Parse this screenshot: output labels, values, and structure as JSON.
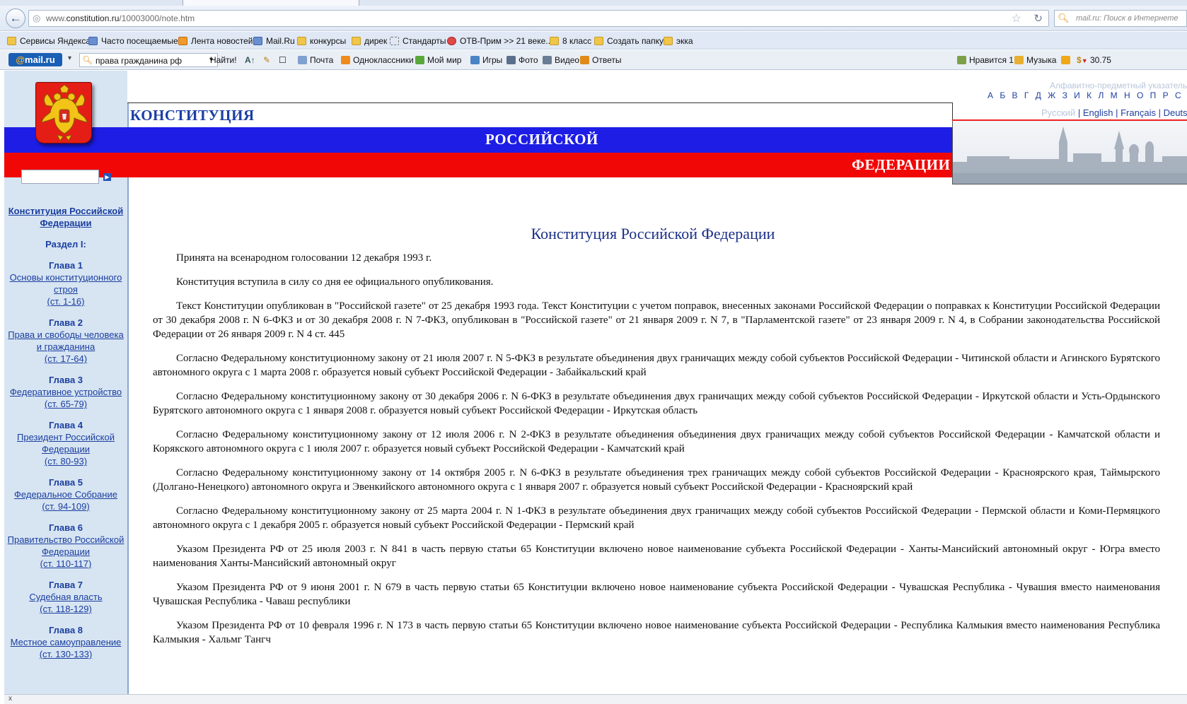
{
  "browser": {
    "url_prefix": "www.",
    "url_domain": "constitution.ru",
    "url_path": "/10003000/note.htm",
    "search_placeholder": "mail.ru: Поиск в Интернете"
  },
  "bookmarks": [
    "Сервисы Яндекса",
    "Часто посещаемые",
    "Лента новостей",
    "Mail.Ru",
    "конкурсы",
    "дирек",
    "Стандарты",
    "ОТВ-Прим >> 21 веке...",
    "8 класс",
    "Создать папку",
    "экка"
  ],
  "mailbar": {
    "logo_at": "@",
    "logo_text": "mail.ru",
    "search_value": "права гражданина рф",
    "find_label": "Найти!",
    "links": [
      "Почта",
      "Одноклассники",
      "Мой мир",
      "Игры",
      "Фото",
      "Видео",
      "Ответы"
    ],
    "likes_label": "Нравится 1",
    "music_label": "Музыка",
    "rate_label": "30.75"
  },
  "site": {
    "header_word1": "КОНСТИТУЦИЯ",
    "header_word2": "РОССИЙСКОЙ",
    "header_word3": "ФЕДЕРАЦИИ",
    "alpha_index_title": "Алфавитно-предметный указатель",
    "alpha_letters": "А Б В Г Д Ж З И К Л М Н О П Р С Т У Ф Ц Ч Я",
    "lang_current": "Русский",
    "lang_en": "English",
    "lang_fr": "Français",
    "lang_de": "Deutsch",
    "lang_sep": " | "
  },
  "toc": {
    "title": "Конституция Российской Федерации",
    "section": "Раздел I:",
    "chapters": [
      {
        "head": "Глава 1",
        "title": "Основы конституционного строя",
        "range": "(ст. 1-16)"
      },
      {
        "head": "Глава 2",
        "title": "Права и свободы человека и гражданина",
        "range": "(ст. 17-64)"
      },
      {
        "head": "Глава 3",
        "title": "Федеративное устройство",
        "range": "(ст. 65-79)"
      },
      {
        "head": "Глава 4",
        "title": "Президент Российской Федерации",
        "range": "(ст. 80-93)"
      },
      {
        "head": "Глава 5",
        "title": "Федеральное Собрание",
        "range": "(ст. 94-109)"
      },
      {
        "head": "Глава 6",
        "title": "Правительство Российской Федерации",
        "range": "(ст. 110-117)"
      },
      {
        "head": "Глава 7",
        "title": "Судебная власть",
        "range": "(ст. 118-129)"
      },
      {
        "head": "Глава 8",
        "title": "Местное самоуправление",
        "range": "(ст. 130-133)"
      }
    ]
  },
  "document": {
    "title": "Конституция Российской Федерации",
    "paragraphs": [
      "Принята на всенародном голосовании 12 декабря 1993 г.",
      "Конституция вступила в силу со дня ее официального опубликования.",
      "Текст Конституции опубликован в \"Российской газете\" от 25 декабря 1993 года. Текст Конституции с учетом поправок, внесенных законами Российской Федерации о поправках к Конституции Российской Федерации от 30 декабря 2008 г. N 6-ФКЗ и от 30 декабря 2008 г. N 7-ФКЗ, опубликован в \"Российской газете\" от 21 января 2009 г. N 7, в \"Парламентской газете\" от 23 января 2009 г. N 4, в Собрании законодательства Российской Федерации от 26 января 2009 г. N 4 ст. 445",
      "Согласно Федеральному конституционному закону от 21 июля 2007 г. N 5-ФКЗ в результате объединения двух граничащих между собой субъектов Российской Федерации - Читинской области и Агинского Бурятского автономного округа с 1 марта 2008 г. образуется новый субъект Российской Федерации - Забайкальский край",
      "Согласно Федеральному конституционному закону от 30 декабря 2006 г. N 6-ФКЗ в результате объединения двух граничащих между собой субъектов Российской Федерации - Иркутской области и Усть-Ордынского Бурятского автономного округа с 1 января 2008 г. образуется новый субъект Российской Федерации - Иркутская область",
      "Согласно Федеральному конституционному закону от 12 июля 2006 г. N 2-ФКЗ в результате объединения объединения двух граничащих между собой субъектов Российской Федерации - Камчатской области и Корякского автономного округа с 1 июля 2007 г. образуется новый субъект Российской Федерации - Камчатский край",
      "Согласно Федеральному конституционному закону от 14 октября 2005 г. N 6-ФКЗ в результате объединения трех граничащих между собой субъектов Российской Федерации - Красноярского края, Таймырского (Долгано-Ненецкого) автономного округа и Эвенкийского автономного округа с 1 января 2007 г. образуется новый субъект Российской Федерации - Красноярский край",
      "Согласно Федеральному конституционному закону от 25 марта 2004 г. N 1-ФКЗ в результате объединения двух граничащих между собой субъектов Российской Федерации - Пермской области и Коми-Пермяцкого автономного округа с 1 декабря 2005 г. образуется новый субъект Российской Федерации - Пермский край",
      "Указом Президента РФ от 25 июля 2003 г. N 841 в часть первую статьи 65 Конституции включено новое наименование субъекта Российской Федерации - Ханты-Мансийский автономный округ - Югра вместо наименования Ханты-Мансийский автономный округ",
      "Указом Президента РФ от 9 июня 2001 г. N 679 в часть первую статьи 65 Конституции включено новое наименование субъекта Российской Федерации - Чувашская Республика - Чувашия вместо наименования Чувашская Республика - Чаваш республики",
      "Указом Президента РФ от 10 февраля 1996 г. N 173 в часть первую статьи 65 Конституции включено новое наименование субъекта Российской Федерации - Республика Калмыкия вместо наименования Республика Калмыкия - Хальмг Тангч"
    ]
  },
  "status": {
    "text": "x"
  }
}
